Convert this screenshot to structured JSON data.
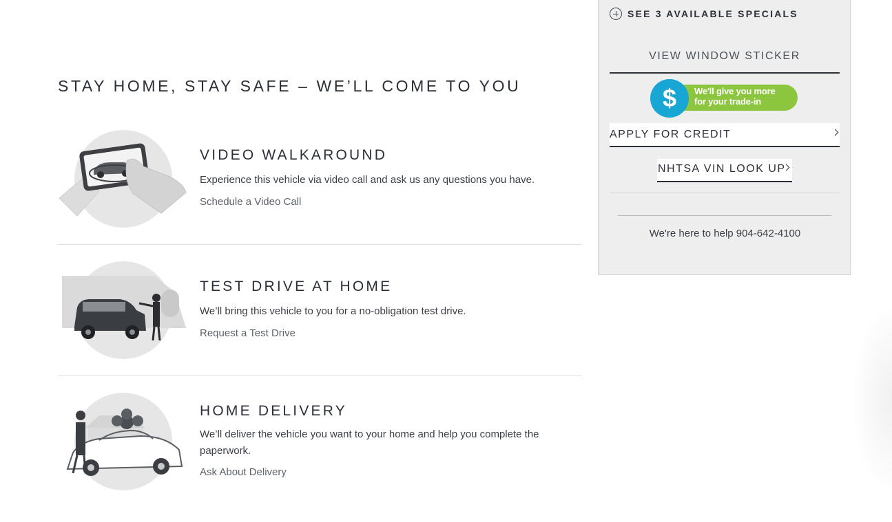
{
  "main": {
    "heading": "STAY HOME, STAY SAFE – WE’LL COME TO YOU",
    "features": [
      {
        "title": "VIDEO WALKAROUND",
        "description": "Experience this vehicle via video call and ask us any questions you have.",
        "link": "Schedule a Video Call",
        "illustration": "video-call-phone-icon"
      },
      {
        "title": "TEST DRIVE AT HOME",
        "description": "We’ll bring this vehicle to you for a no-obligation test drive.",
        "link": "Request a Test Drive",
        "illustration": "suv-home-test-drive-icon"
      },
      {
        "title": "HOME DELIVERY",
        "description": "We’ll deliver the vehicle you want to your home and help you complete the paperwork.",
        "link": "Ask About Delivery",
        "illustration": "car-with-bow-delivery-icon"
      }
    ]
  },
  "sidebar": {
    "specials": "SEE 3 AVAILABLE SPECIALS",
    "window_sticker": "VIEW WINDOW STICKER",
    "tradein_line1": "We'll give you more",
    "tradein_line2": "for your trade-in",
    "tradein_symbol": "$",
    "apply_credit": "APPLY FOR CREDIT",
    "nhtsa": "NHTSA VIN LOOK UP",
    "help": "We're here to help 904-642-4100"
  },
  "colors": {
    "panel_bg": "#eeeeee",
    "tradein_green": "#8cc63f",
    "tradein_blue": "#18a7d4",
    "text_dark": "#2b3038"
  }
}
